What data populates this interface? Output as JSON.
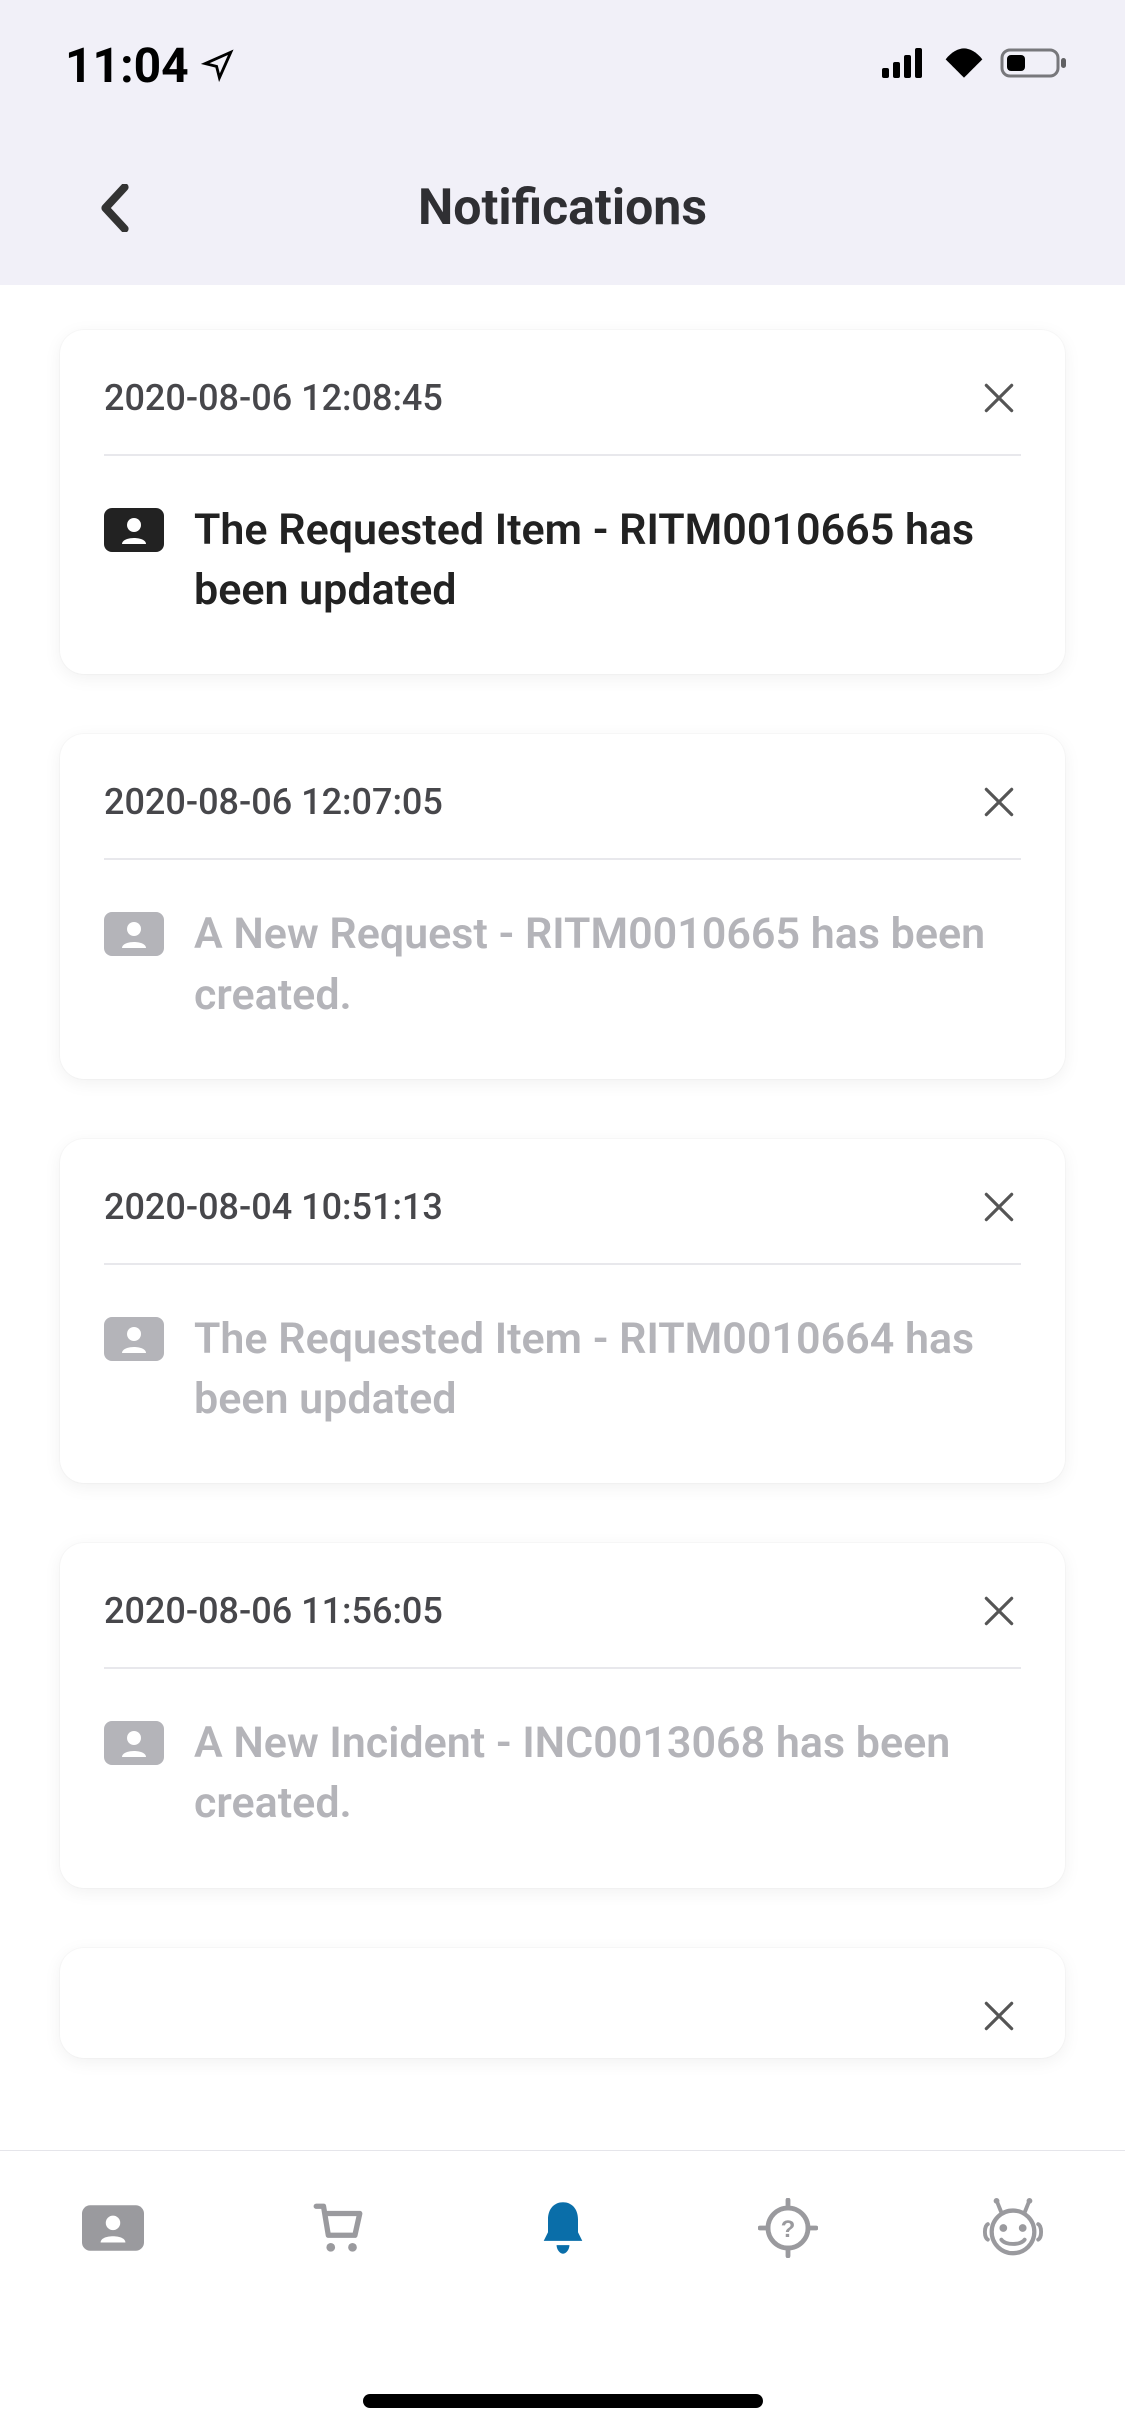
{
  "status_bar": {
    "time": "11:04"
  },
  "header": {
    "title": "Notifications"
  },
  "notifications": [
    {
      "timestamp": "2020-08-06 12:08:45",
      "message": "The Requested Item - RITM0010665 has been updated",
      "state": "unread"
    },
    {
      "timestamp": "2020-08-06 12:07:05",
      "message": "A New Request - RITM0010665 has been created.",
      "state": "read"
    },
    {
      "timestamp": "2020-08-04 10:51:13",
      "message": "The Requested Item - RITM0010664 has been updated",
      "state": "read"
    },
    {
      "timestamp": "2020-08-06 11:56:05",
      "message": "A New Incident - INC0013068 has been created.",
      "state": "read"
    }
  ],
  "bottom_nav": {
    "items": [
      {
        "name": "contacts",
        "active": false
      },
      {
        "name": "cart",
        "active": false
      },
      {
        "name": "notifications",
        "active": true
      },
      {
        "name": "help",
        "active": false
      },
      {
        "name": "chatbot",
        "active": false
      }
    ]
  }
}
